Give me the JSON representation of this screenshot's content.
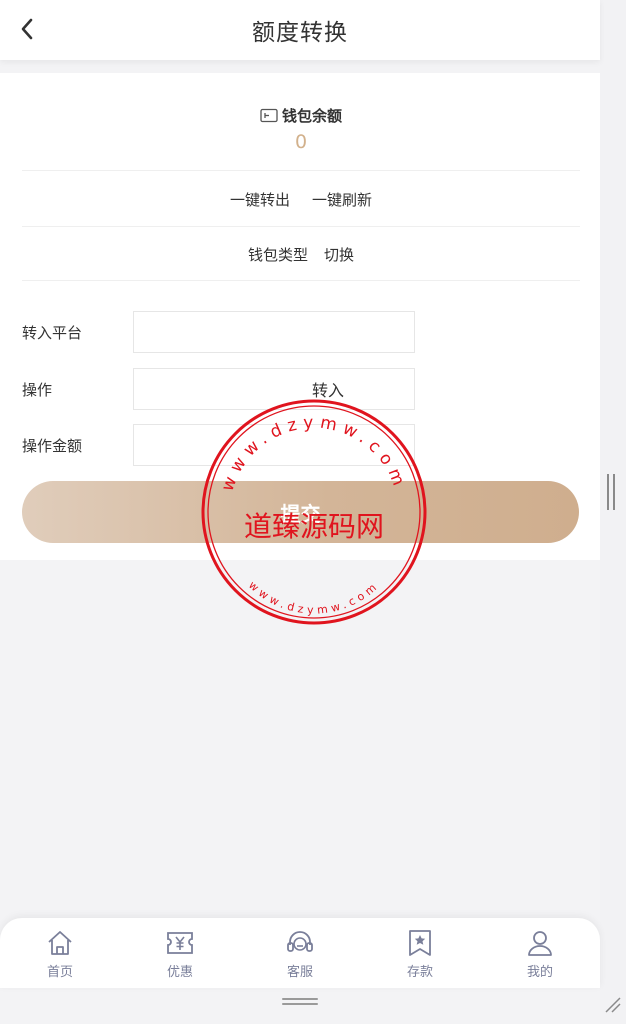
{
  "header": {
    "title": "额度转换"
  },
  "wallet": {
    "label": "钱包余额",
    "balance": "0"
  },
  "actions": {
    "transfer_out_all": "一键转出",
    "refresh_all": "一键刷新"
  },
  "wallet_type": {
    "label": "钱包类型",
    "switch": "切换"
  },
  "form": {
    "platform_label": "转入平台",
    "platform_value": "",
    "operation_label": "操作",
    "operation_value": "转入",
    "amount_label": "操作金额",
    "amount_value": ""
  },
  "submit": {
    "label": "提交"
  },
  "watermark": {
    "name": "道臻源码网",
    "ring_top": "www.dzymw.com",
    "ring_bottom": "www.dzymw.com"
  },
  "bottom_nav": {
    "items": [
      {
        "label": "首页",
        "icon": "home-icon"
      },
      {
        "label": "优惠",
        "icon": "coupon-icon"
      },
      {
        "label": "客服",
        "icon": "headset-icon"
      },
      {
        "label": "存款",
        "icon": "deposit-icon"
      },
      {
        "label": "我的",
        "icon": "user-icon"
      }
    ]
  },
  "colors": {
    "accent": "#d2b18c",
    "nav_icon": "#7a7f9a",
    "stamp": "#e0141e"
  }
}
